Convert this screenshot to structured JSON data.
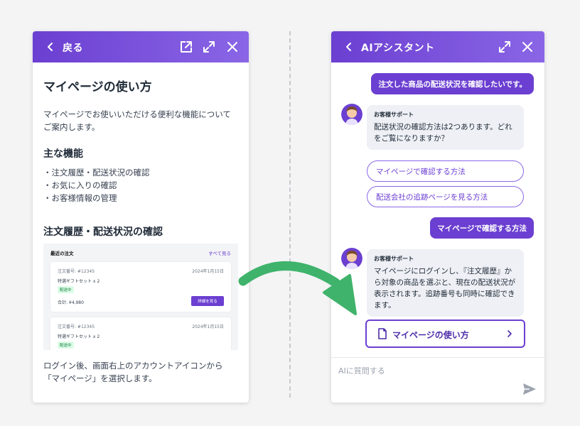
{
  "left_panel": {
    "header": {
      "back_label": "戻る"
    },
    "doc": {
      "title": "マイページの使い方",
      "intro": "マイページでお使いいただける便利な機能についてご案内します。",
      "features_heading": "主な機能",
      "features": [
        "注文履歴・配送状況の確認",
        "お気に入りの確認",
        "お客様情報の管理"
      ],
      "section_heading": "注文履歴・配送状況の確認",
      "preview": {
        "heading": "最近の注文",
        "see_all": "すべて見る",
        "orders": [
          {
            "number": "注文番号: #12345",
            "date": "2024年1月15日",
            "item": "特選ギフトセット x 2",
            "status": "配送中",
            "total": "合計: ¥4,980",
            "detail_label": "詳細を見る"
          },
          {
            "number": "注文番号: #12345",
            "date": "2024年1月15日",
            "item": "特選ギフトセット x 2",
            "status": "配送中"
          }
        ]
      },
      "footer": "ログイン後、画面右上のアカウントアイコンから「マイページ」を選択します。"
    }
  },
  "right_panel": {
    "header": {
      "title": "AIアシスタント"
    },
    "messages": {
      "user1": "注文した商品の配送状況を確認したいです。",
      "bot1_name": "お客様サポート",
      "bot1_text": "配送状況の確認方法は2つあります。どれをご覧になりますか？",
      "option1": "マイページで確認する方法",
      "option2": "配送会社の追跡ページを見る方法",
      "user2": "マイページで確認する方法",
      "bot2_name": "お客様サポート",
      "bot2_text": "マイページにログインし、『注文履歴』から対象の商品を選ぶと、現在の配送状況が表示されます。追跡番号も同時に確認できます。",
      "doc_link": "マイページの使い方"
    },
    "composer": {
      "placeholder": "AIに質問する"
    }
  },
  "colors": {
    "accent": "#6b3fd1",
    "accent_light": "#8a66e6",
    "arrow": "#3fb36b"
  }
}
